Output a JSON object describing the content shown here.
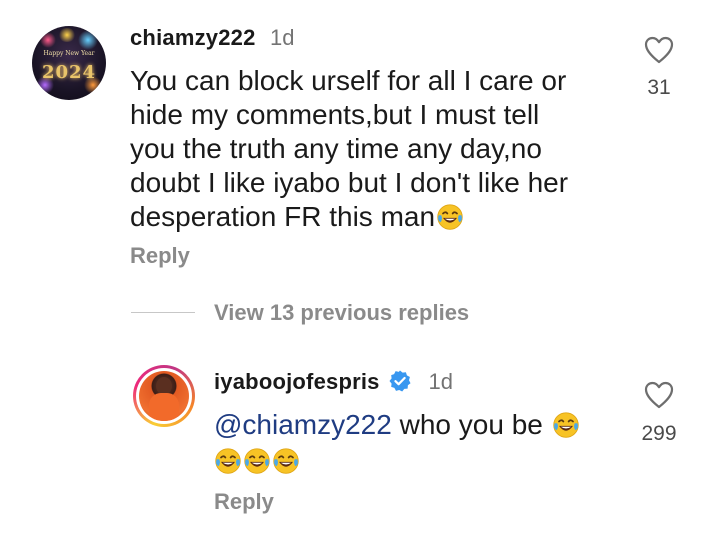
{
  "comment": {
    "username": "chiamzy222",
    "time": "1d",
    "lines": [
      "You can block urself for all I care or",
      "hide my comments,but I must tell",
      "you the truth any time any day,no",
      "doubt I like iyabo but I don't like her",
      "desperation FR this man"
    ],
    "likes": "31",
    "reply_label": "Reply",
    "avatar_icon": "new-year-2024-avatar",
    "avatar_text": {
      "greeting": "Happy New Year",
      "year": "2024"
    }
  },
  "replies_toggle": {
    "label": "View 13 previous replies"
  },
  "reply": {
    "username": "iyaboojofespris",
    "verified": true,
    "time": "1d",
    "mention": "@chiamzy222",
    "text": " who you be ",
    "likes": "299",
    "reply_label": "Reply",
    "avatar_icon": "profile-photo-avatar"
  },
  "icons": {
    "like": "heart-outline-icon",
    "emoji": "face-with-tears-of-joy-emoji",
    "verified": "verified-badge-icon"
  },
  "colors": {
    "accent_blue": "#3897f0",
    "mention": "#1f3c82",
    "muted": "#8a8a8a",
    "divider": "#c7c7c7"
  }
}
